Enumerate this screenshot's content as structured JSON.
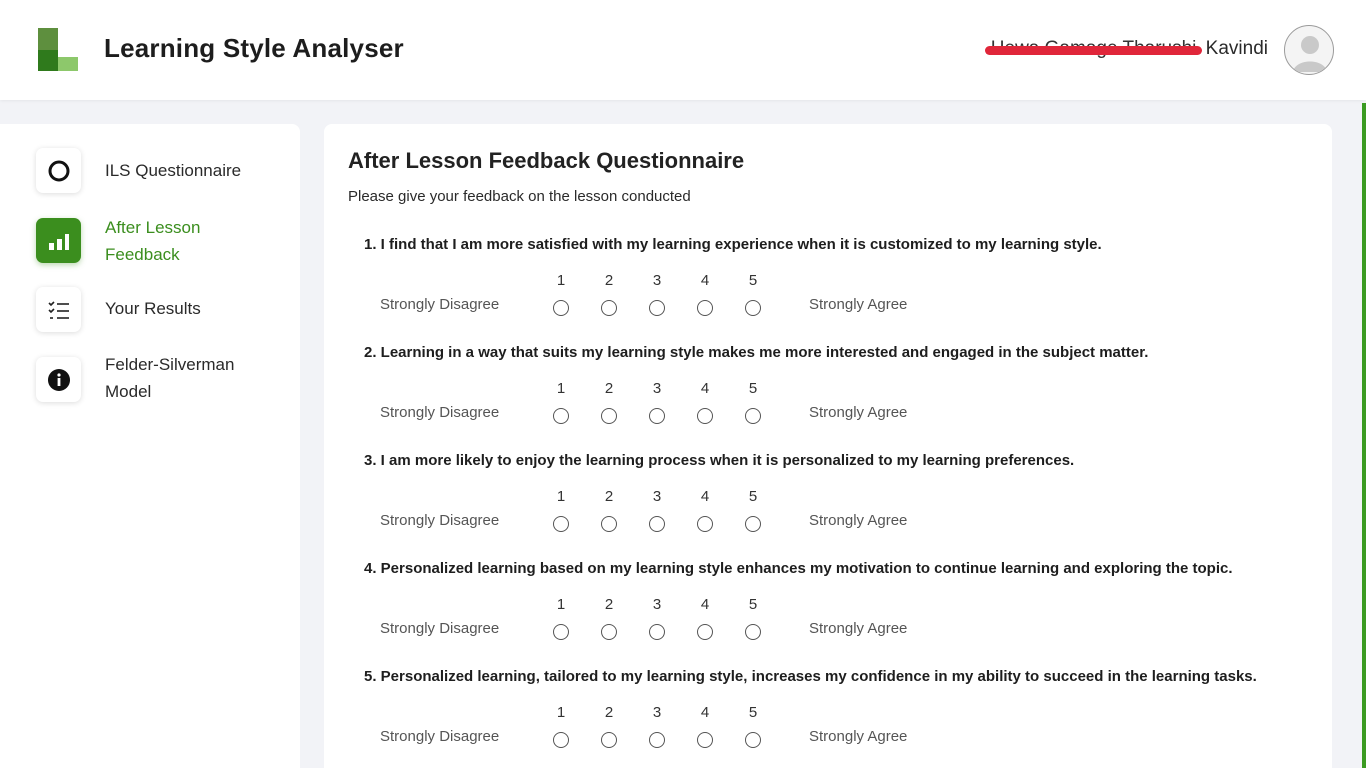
{
  "header": {
    "app_title": "Learning Style Analyser",
    "user_name_redacted": "Hewa Gamage Tharushi",
    "user_name_visible": "Kavindi"
  },
  "sidebar": {
    "items": [
      {
        "label": "ILS Questionnaire",
        "icon": "circle-icon",
        "active": false
      },
      {
        "label": "After Lesson Feedback",
        "icon": "bar-chart-icon",
        "active": true
      },
      {
        "label": "Your Results",
        "icon": "checklist-icon",
        "active": false
      },
      {
        "label": "Felder-Silverman Model",
        "icon": "info-icon",
        "active": false
      }
    ]
  },
  "main": {
    "title": "After Lesson Feedback Questionnaire",
    "subtitle": "Please give your feedback on the lesson conducted",
    "scale": [
      "1",
      "2",
      "3",
      "4",
      "5"
    ],
    "scale_min_label": "Strongly Disagree",
    "scale_max_label": "Strongly Agree",
    "questions": [
      "1. I find that I am more satisfied with my learning experience when it is customized to my learning style.",
      "2. Learning in a way that suits my learning style makes me more interested and engaged in the subject matter.",
      "3. I am more likely to enjoy the learning process when it is personalized to my learning preferences.",
      "4. Personalized learning based on my learning style enhances my motivation to continue learning and exploring the topic.",
      "5. Personalized learning, tailored to my learning style, increases my confidence in my ability to succeed in the learning tasks."
    ]
  },
  "colors": {
    "accent": "#3b8e1e",
    "redaction": "#e0263a"
  }
}
